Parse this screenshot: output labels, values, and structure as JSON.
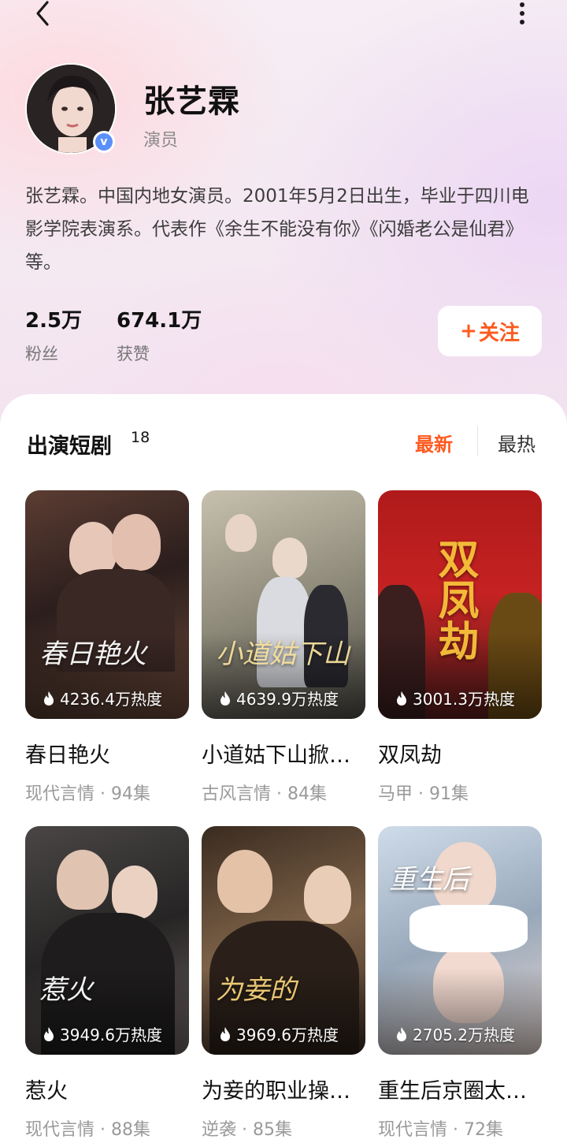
{
  "profile": {
    "name": "张艺霖",
    "role": "演员",
    "verified_mark": "v",
    "bio": "张艺霖。中国内地女演员。2001年5月2日出生，毕业于四川电影学院表演系。代表作《余生不能没有你》《闪婚老公是仙君》等。",
    "fans_value": "2.5万",
    "fans_label": "粉丝",
    "likes_value": "674.1万",
    "likes_label": "获赞",
    "follow_label": "关注",
    "follow_prefix": "+"
  },
  "section": {
    "title": "出演短剧",
    "count": "18",
    "sort_new": "最新",
    "sort_hot": "最热"
  },
  "colors": {
    "accent": "#ff5a1f",
    "verify": "#5b8ff9"
  },
  "dramas": [
    {
      "title": "春日艳火",
      "heat": "4236.4万热度",
      "meta": "现代言情 · 94集",
      "art": "春日艳火"
    },
    {
      "title": "小道姑下山掀…",
      "heat": "4639.9万热度",
      "meta": "古风言情 · 84集",
      "art": "小道姑下山"
    },
    {
      "title": "双凤劫",
      "heat": "3001.3万热度",
      "meta": "马甲 · 91集",
      "art": "双凤劫"
    },
    {
      "title": "惹火",
      "heat": "3949.6万热度",
      "meta": "现代言情 · 88集",
      "art": "惹火"
    },
    {
      "title": "为妾的职业操…",
      "heat": "3969.6万热度",
      "meta": "逆袭 · 85集",
      "art": "为妾的"
    },
    {
      "title": "重生后京圈太…",
      "heat": "2705.2万热度",
      "meta": "现代言情 · 72集",
      "art": "重生后"
    }
  ]
}
